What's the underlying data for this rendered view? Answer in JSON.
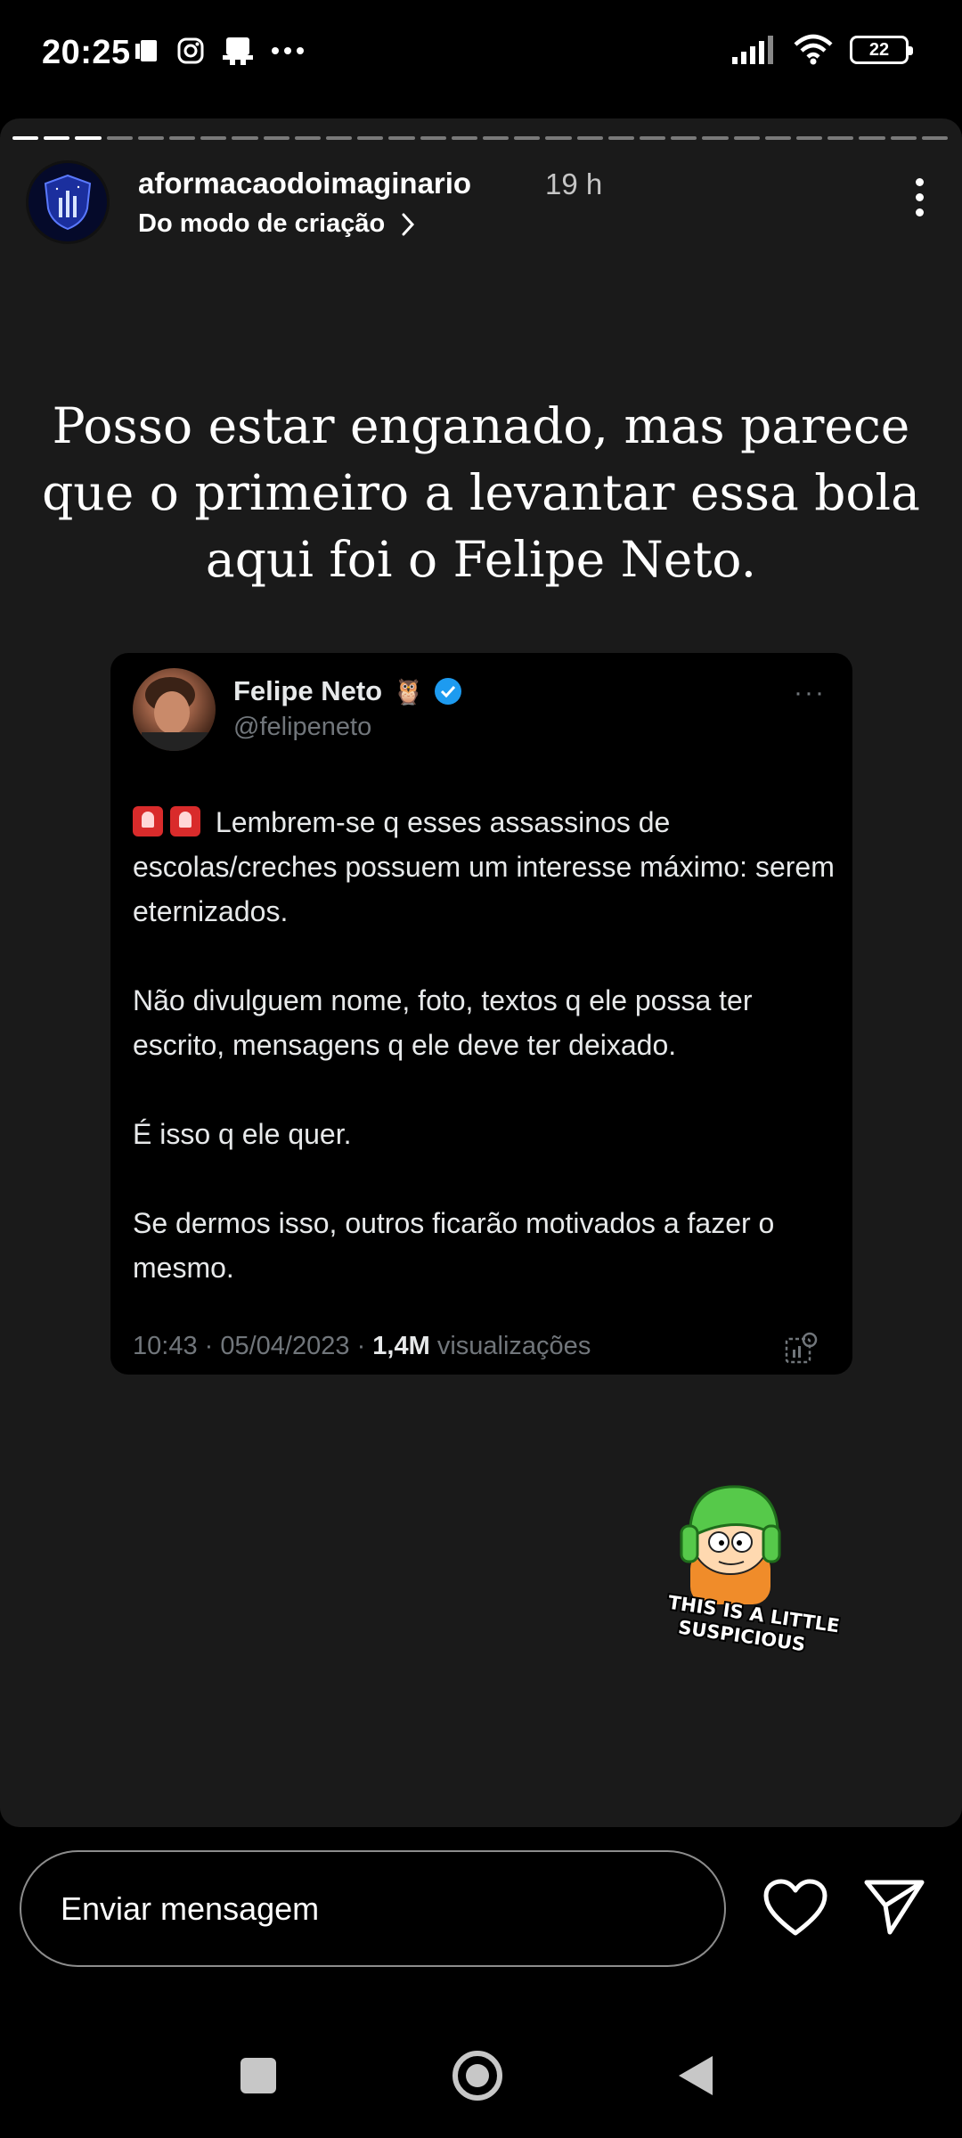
{
  "status_bar": {
    "time": "20:25",
    "left_icons": [
      "sim-card-icon",
      "instagram-icon",
      "notification-icon",
      "more-dots-icon"
    ],
    "right_icons": [
      "signal-icon",
      "wifi-icon",
      "battery-icon"
    ],
    "battery_level": "22"
  },
  "story": {
    "progress_segments": 30,
    "progress_completed": 3,
    "header": {
      "username": "aformacaodoimaginario",
      "time_ago": "19 h",
      "subtitle": "Do modo de criação"
    },
    "text": "Posso estar enganado, mas parece que o primeiro a levantar essa bola aqui foi o Felipe Neto.",
    "tweet": {
      "name": "Felipe Neto",
      "handle": "@felipeneto",
      "more": "···",
      "paragraph1": "Lembrem-se q esses assassinos de escolas/creches possuem um interesse máximo: serem eternizados.",
      "paragraph2": "Não divulguem nome, foto, textos q ele possa ter escrito, mensagens q ele deve ter deixado.",
      "paragraph3": "É isso q ele quer.",
      "paragraph4": "Se dermos isso, outros ficarão motivados a fazer o mesmo.",
      "time": "10:43",
      "date": "05/04/2023",
      "views_count": "1,4M",
      "views_label": "visualizações"
    },
    "sticker": {
      "line1": "THIS IS A LITTLE",
      "line2": "SUSPICIOUS"
    }
  },
  "reply_bar": {
    "placeholder": "Enviar mensagem"
  },
  "colors": {
    "story_bg": "#1a1a1a",
    "tweet_bg": "#000000",
    "verified": "#1d9bf0",
    "muted": "#71767b"
  }
}
